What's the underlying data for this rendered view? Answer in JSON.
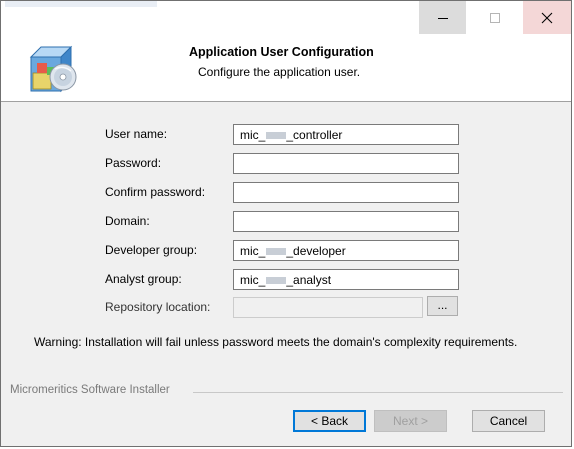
{
  "window": {
    "controls": {
      "minimize": "minimize-icon",
      "maximize": "maximize-icon",
      "close": "close-icon"
    }
  },
  "header": {
    "title": "Application User Configuration",
    "subtitle": "Configure the application user.",
    "icon": "software-installer-icon"
  },
  "form": {
    "fields": [
      {
        "label": "User name:",
        "value_prefix": "mic_",
        "value_suffix": "_controller"
      },
      {
        "label": "Password:",
        "value": ""
      },
      {
        "label": "Confirm password:",
        "value": ""
      },
      {
        "label": "Domain:",
        "value": ""
      },
      {
        "label": "Developer group:",
        "value_prefix": "mic_",
        "value_suffix": "_developer"
      },
      {
        "label": "Analyst group:",
        "value_prefix": "mic_",
        "value_suffix": "_analyst"
      },
      {
        "label": "Repository location:",
        "value": ""
      }
    ],
    "browse_label": "..."
  },
  "warning": "Warning: Installation will fail unless password meets the domain's complexity requirements.",
  "footer": {
    "group_label": "Micromeritics Software Installer",
    "back_label": "< Back",
    "next_label": "Next >",
    "cancel_label": "Cancel"
  }
}
